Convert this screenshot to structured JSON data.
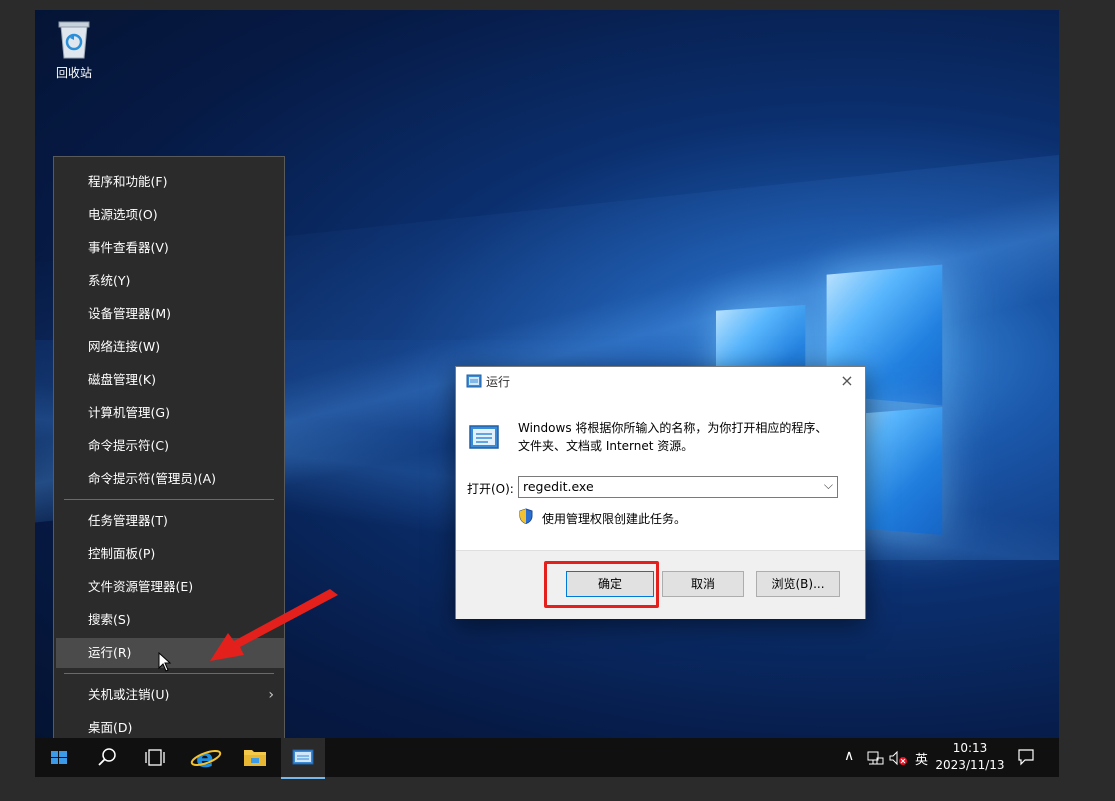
{
  "desktop": {
    "recycle_bin_label": "回收站"
  },
  "context_menu": {
    "items": [
      {
        "label": "程序和功能(F)"
      },
      {
        "label": "电源选项(O)"
      },
      {
        "label": "事件查看器(V)"
      },
      {
        "label": "系统(Y)"
      },
      {
        "label": "设备管理器(M)"
      },
      {
        "label": "网络连接(W)"
      },
      {
        "label": "磁盘管理(K)"
      },
      {
        "label": "计算机管理(G)"
      },
      {
        "label": "命令提示符(C)"
      },
      {
        "label": "命令提示符(管理员)(A)"
      },
      {
        "label": "任务管理器(T)"
      },
      {
        "label": "控制面板(P)"
      },
      {
        "label": "文件资源管理器(E)"
      },
      {
        "label": "搜索(S)"
      },
      {
        "label": "运行(R)",
        "hovered": true
      },
      {
        "label": "关机或注销(U)",
        "submenu_arrow": "›"
      },
      {
        "label": "桌面(D)"
      }
    ]
  },
  "run_dialog": {
    "title": "运行",
    "close_glyph": "×",
    "description": "Windows 将根据你所输入的名称，为你打开相应的程序、文件夹、文档或 Internet 资源。",
    "open_label": "打开(O):",
    "input_value": "regedit.exe",
    "dropdown_glyph": "⌵",
    "admin_note": "使用管理权限创建此任务。",
    "buttons": {
      "ok": "确定",
      "cancel": "取消",
      "browse": "浏览(B)..."
    }
  },
  "taskbar": {
    "tray_up_arrow": "∧",
    "ime_label": "英",
    "time": "10:13",
    "date": "2023/11/13"
  },
  "colors": {
    "annotation_red": "#e3201b",
    "menu_bg": "#2b2b2b",
    "taskbar_bg": "#101010",
    "accent_blue": "#0078d7"
  }
}
